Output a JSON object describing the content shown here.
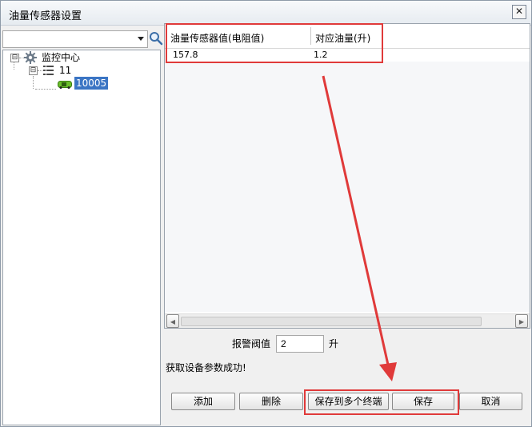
{
  "window": {
    "title": "油量传感器设置",
    "close_glyph": "✕"
  },
  "left_panel": {
    "combo_value": "",
    "tree": {
      "root_label": "监控中心",
      "root_expander": "⊟",
      "group_label": "11",
      "group_expander": "⊟",
      "vehicle_label": "10005"
    }
  },
  "grid": {
    "headers": [
      "油量传感器值(电阻值)",
      "对应油量(升)"
    ],
    "rows": [
      [
        "157.8",
        "1.2"
      ]
    ],
    "scroll_left": "◀",
    "scroll_right": "▶"
  },
  "alarm": {
    "label": "报警阀值",
    "value": "2",
    "unit": "升"
  },
  "status_text": "获取设备参数成功!",
  "buttons": {
    "add": "添加",
    "delete": "删除",
    "save_multi": "保存到多个终端",
    "save": "保存",
    "cancel": "取消"
  },
  "colors": {
    "highlight": "#e03a3a",
    "selection": "#3b75c4"
  }
}
